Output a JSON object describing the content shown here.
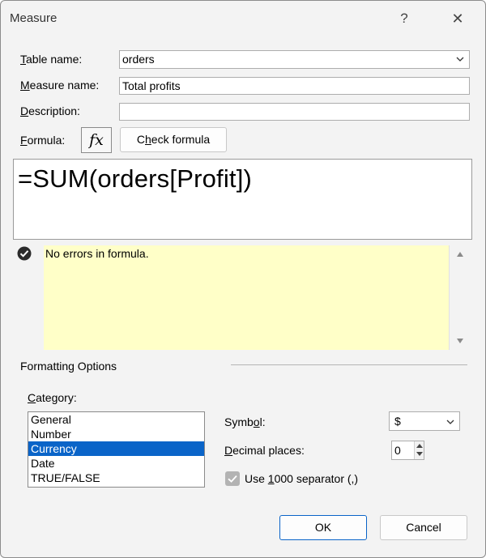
{
  "window": {
    "title": "Measure",
    "help_label": "?",
    "close_label": "✕"
  },
  "fields": {
    "table_name": {
      "label_prefix": "",
      "label_mnemonic": "T",
      "label_rest": "able name:",
      "value": "orders"
    },
    "measure_name": {
      "label_mnemonic": "M",
      "label_rest": "easure name:",
      "value": "Total profits"
    },
    "description": {
      "label_mnemonic": "D",
      "label_rest": "escription:",
      "value": ""
    },
    "formula": {
      "label_mnemonic": "F",
      "label_rest": "ormula:"
    }
  },
  "formula_toolbar": {
    "fx_label": "fx",
    "check_label_pre": "C",
    "check_label_mnemonic": "h",
    "check_label_rest": "eck formula"
  },
  "formula_text": "=SUM(orders[Profit])",
  "status": {
    "message": "No errors in formula.",
    "icon": "check-circle-icon"
  },
  "formatting": {
    "section_title": "Formatting Options",
    "category_label_mnemonic": "C",
    "category_label_rest": "ategory:",
    "categories": [
      "General",
      "Number",
      "Currency",
      "Date",
      "TRUE/FALSE"
    ],
    "selected_category": "Currency",
    "symbol_label_pre": "Symb",
    "symbol_label_mnemonic": "o",
    "symbol_label_rest": "l:",
    "symbol_value": "$",
    "decimal_label_mnemonic": "D",
    "decimal_label_rest": "ecimal places:",
    "decimal_value": "0",
    "separator_label_pre": "Use ",
    "separator_label_mnemonic": "1",
    "separator_label_rest": "000 separator (,)",
    "separator_checked": true
  },
  "buttons": {
    "ok_label": "OK",
    "cancel_label": "Cancel"
  },
  "colors": {
    "selection": "#0a64c8",
    "message_background": "#ffffc8"
  }
}
